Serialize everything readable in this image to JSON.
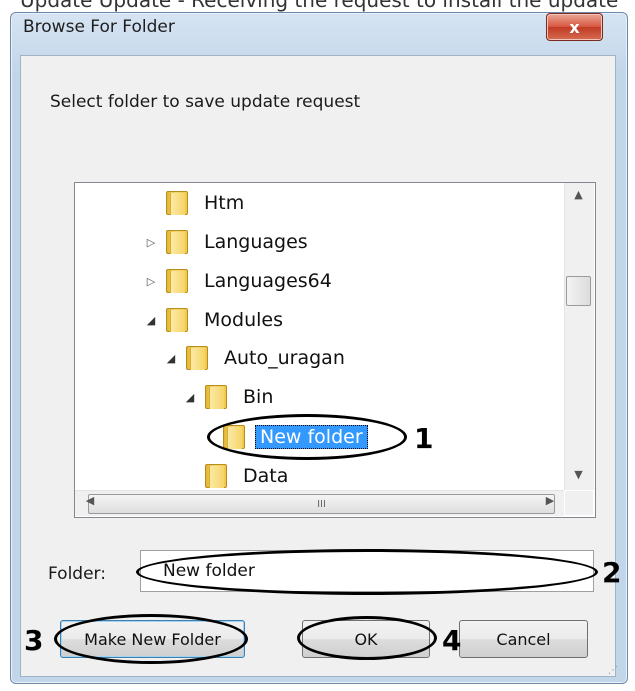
{
  "background_text": "Update Update - Receiving the request to install the update",
  "dialog": {
    "title": "Browse For Folder",
    "close_glyph": "x",
    "description": "Select folder to save update request",
    "tree": {
      "items": [
        {
          "label": "Htm",
          "expander": ""
        },
        {
          "label": "Languages",
          "expander": "▷"
        },
        {
          "label": "Languages64",
          "expander": "▷"
        },
        {
          "label": "Modules",
          "expander": "◢"
        },
        {
          "label": "Auto_uragan",
          "expander": "◢"
        },
        {
          "label": "Bin",
          "expander": "◢"
        },
        {
          "label": "New folder",
          "expander": "",
          "selected": true
        },
        {
          "label": "Data",
          "expander": ""
        }
      ],
      "hscroll_grip": "III"
    },
    "folder_label": "Folder:",
    "folder_value": "New folder",
    "buttons": {
      "make_new_folder": "Make New Folder",
      "ok": "OK",
      "cancel": "Cancel"
    }
  },
  "callouts": [
    "1",
    "2",
    "3",
    "4"
  ],
  "colors": {
    "selection": "#3399ff",
    "close_button": "#c03b24",
    "frame": "#c2d6ea"
  }
}
